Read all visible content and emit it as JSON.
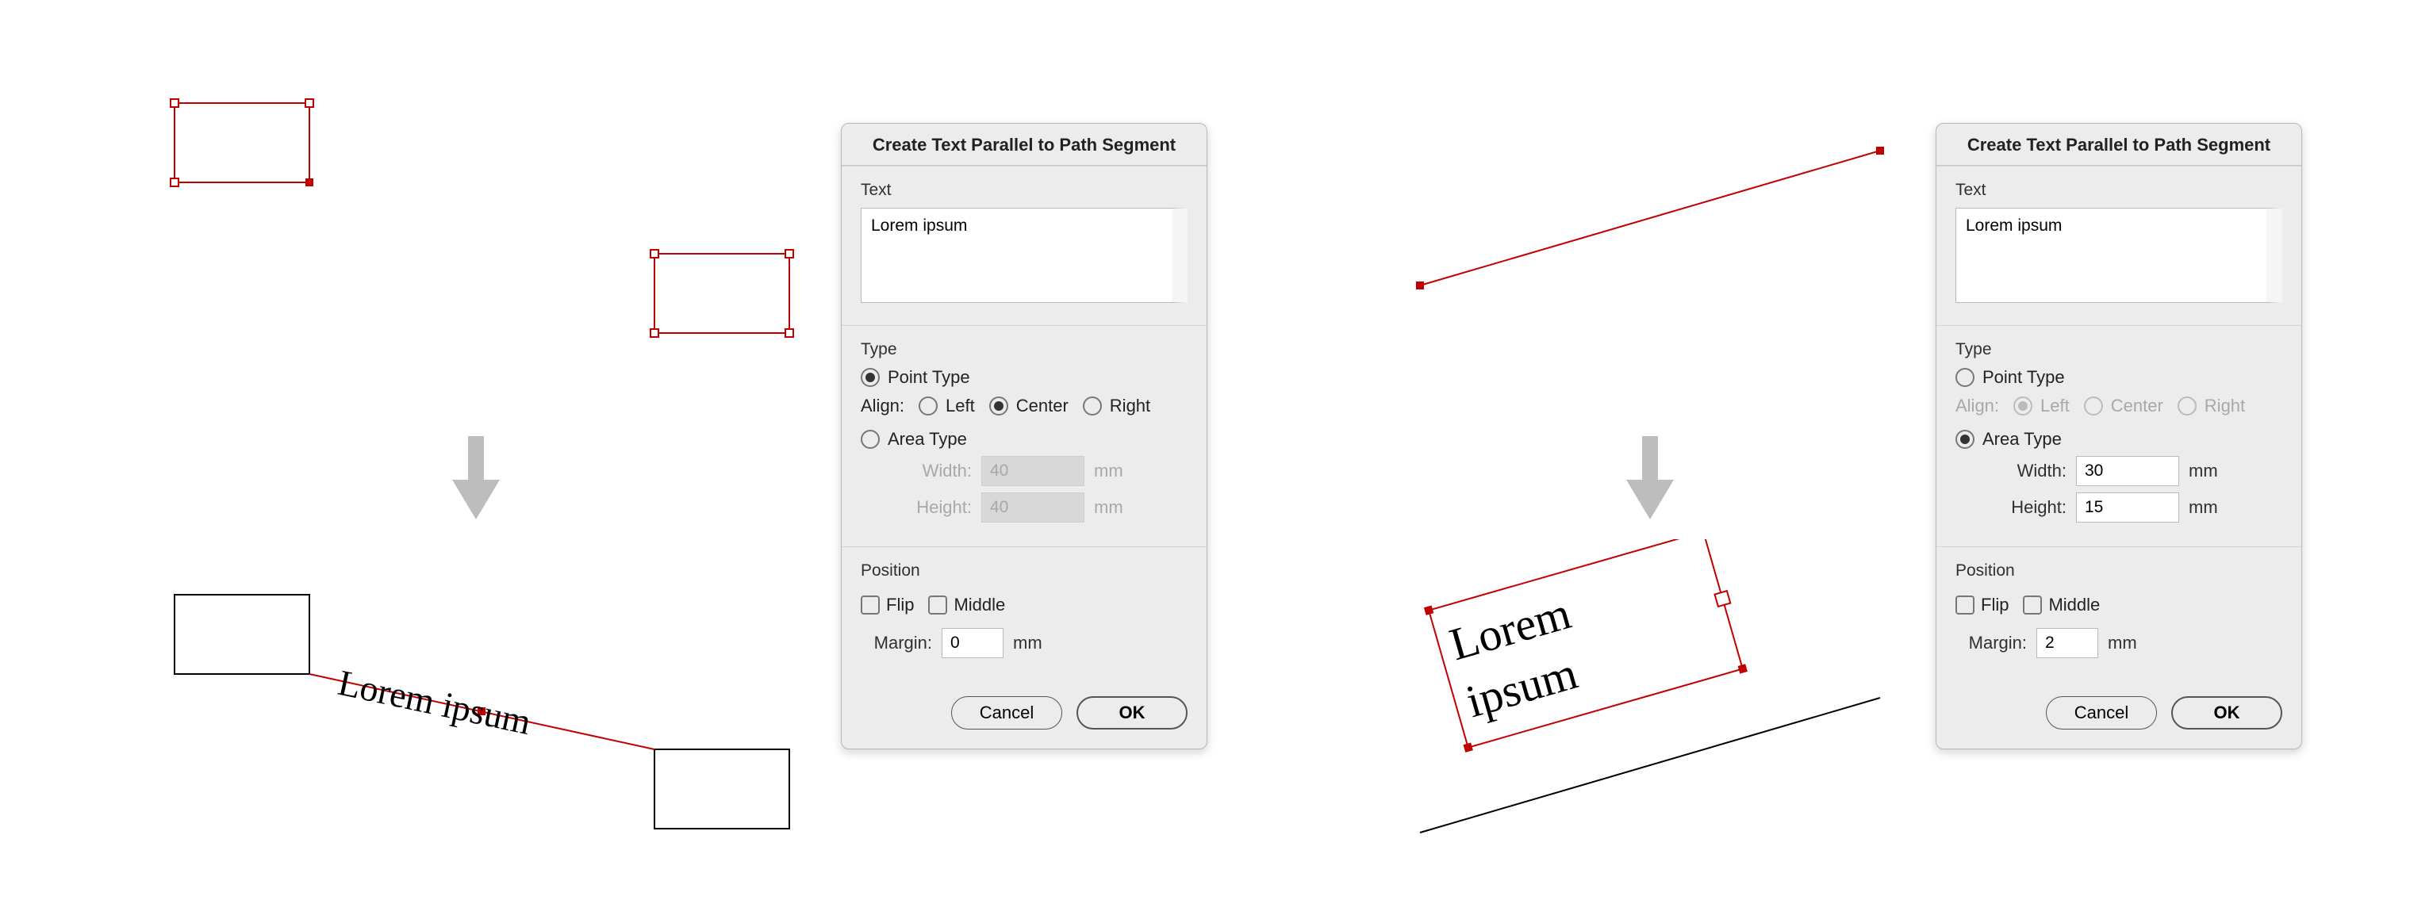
{
  "dialogTitle": "Create Text Parallel to Path Segment",
  "labels": {
    "textSection": "Text",
    "typeSection": "Type",
    "positionSection": "Position",
    "pointType": "Point Type",
    "areaType": "Area Type",
    "align": "Align:",
    "alignLeft": "Left",
    "alignCenter": "Center",
    "alignRight": "Right",
    "width": "Width:",
    "height": "Height:",
    "flip": "Flip",
    "middle": "Middle",
    "margin": "Margin:",
    "unit": "mm",
    "cancel": "Cancel",
    "ok": "OK"
  },
  "left": {
    "textValue": "Lorem ipsum",
    "typeSelected": "point",
    "alignSelected": "center",
    "width": "40",
    "height": "40",
    "flip": false,
    "middle": false,
    "margin": "0",
    "resultText": "Lorem ipsum"
  },
  "right": {
    "textValue": "Lorem ipsum",
    "typeSelected": "area",
    "alignSelected": "left",
    "width": "30",
    "height": "15",
    "flip": false,
    "middle": false,
    "margin": "2",
    "resultLine1": "Lorem",
    "resultLine2": "ipsum"
  }
}
